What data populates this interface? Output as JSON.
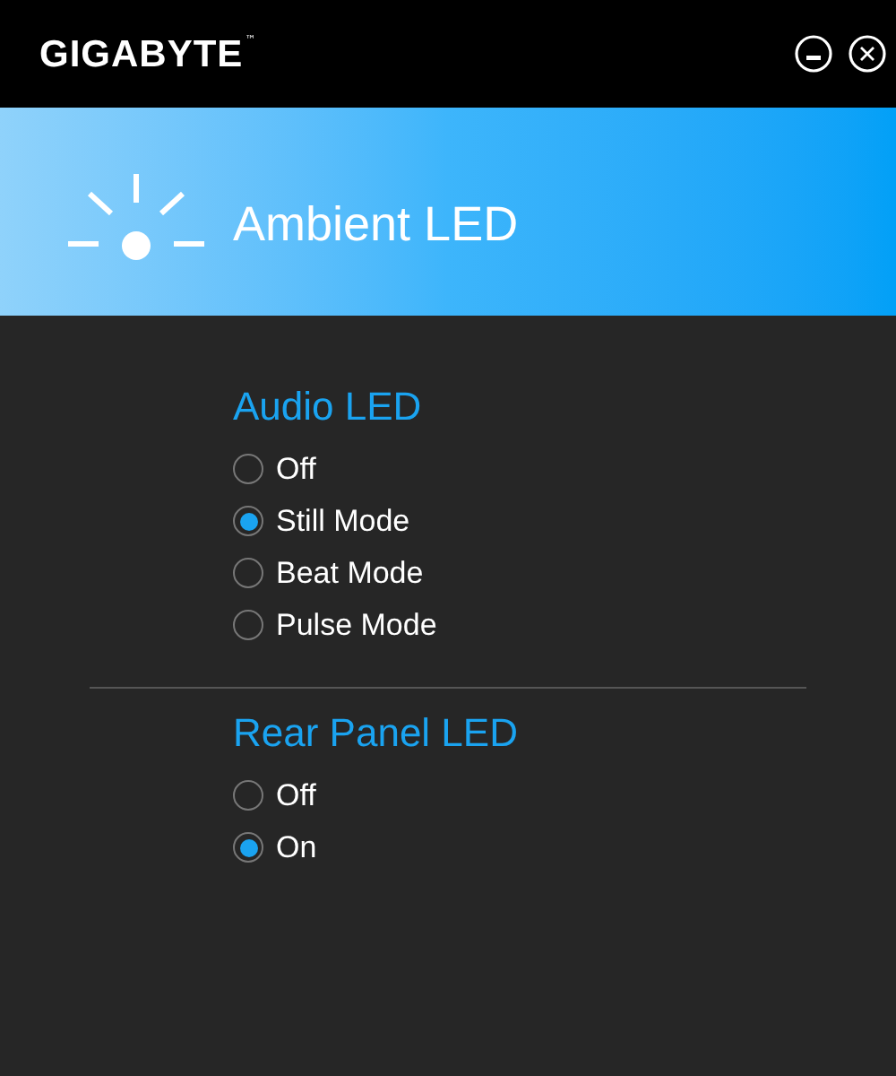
{
  "window": {
    "logo": "GIGABYTE",
    "trademark": "™"
  },
  "banner": {
    "title": "Ambient LED"
  },
  "sections": [
    {
      "title": "Audio LED",
      "options": [
        {
          "label": "Off",
          "selected": false
        },
        {
          "label": "Still Mode",
          "selected": true
        },
        {
          "label": "Beat Mode",
          "selected": false
        },
        {
          "label": "Pulse Mode",
          "selected": false
        }
      ]
    },
    {
      "title": "Rear Panel LED",
      "options": [
        {
          "label": "Off",
          "selected": false
        },
        {
          "label": "On",
          "selected": true
        }
      ]
    }
  ]
}
